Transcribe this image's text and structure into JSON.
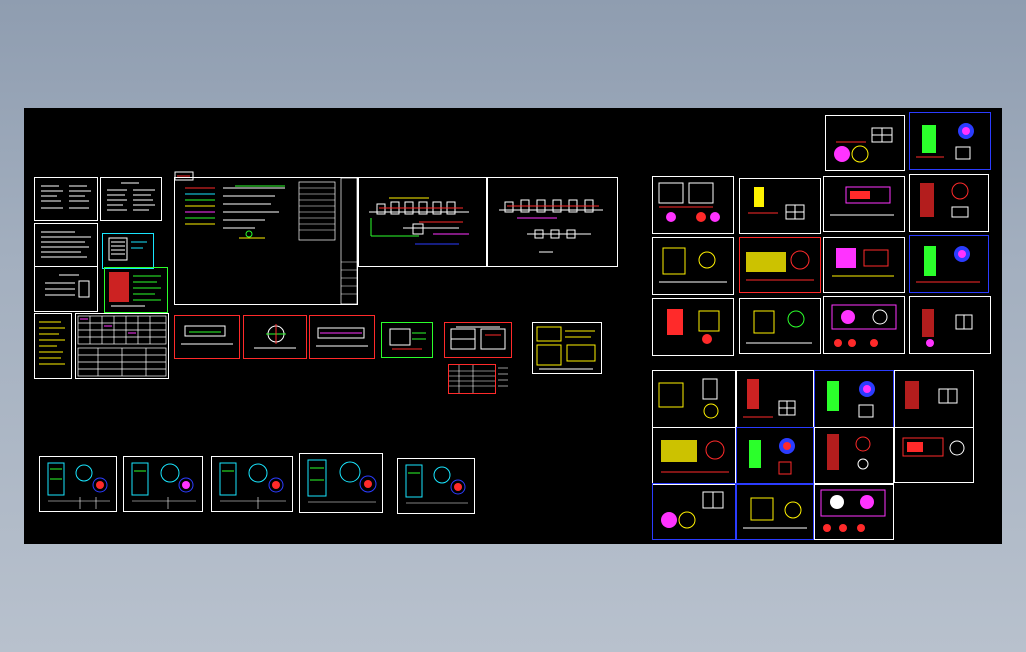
{
  "app": {
    "window_title": "",
    "background": "#96a3b5",
    "canvas_color": "#000000"
  },
  "canvas": {
    "drawing_sheets": {
      "left_index_sheets": 6,
      "system_diagram_sheets": 3,
      "bottom_pump_sheets": 5,
      "right_equipment_sheets": 25
    },
    "colors": {
      "white": "#ffffff",
      "red": "#ff2a2a",
      "blue": "#2b3cff",
      "green": "#2bff2b",
      "cyan": "#19e6ff",
      "yellow": "#fff200",
      "magenta": "#ff33ff"
    }
  }
}
